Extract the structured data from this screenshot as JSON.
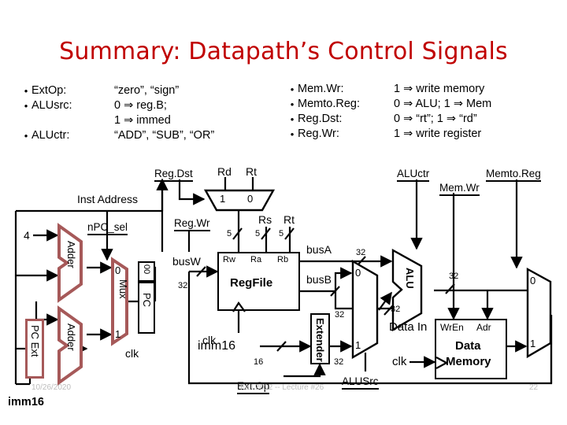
{
  "slide": {
    "title": "Summary: Datapath’s Control Signals"
  },
  "bullets_left": [
    {
      "name": "ExtOp:",
      "value": "“zero”, “sign”"
    },
    {
      "name": "ALUsrc:",
      "value": "0 ⇒ reg.B;"
    },
    {
      "name": "",
      "value": "1 ⇒ immed"
    },
    {
      "name": "ALUctr:",
      "value": "“ADD”, “SUB”, “OR”"
    }
  ],
  "bullets_right": [
    {
      "name": "Mem.Wr:",
      "value": "1 ⇒ write memory"
    },
    {
      "name": "Memto.Reg:",
      "value": "0 ⇒ ALU; 1 ⇒ Mem"
    },
    {
      "name": "Reg.Dst:",
      "value": "0 ⇒ “rt”; 1 ⇒ “rd”"
    },
    {
      "name": "Reg.Wr:",
      "value": "1 ⇒ write register"
    }
  ],
  "diagram": {
    "control_signals": {
      "npc_sel": "nPC_sel",
      "reg_dst": "Reg.Dst",
      "reg_wr": "Reg.Wr",
      "alu_ctr": "ALUctr",
      "mem_wr": "Mem.Wr",
      "memto_reg": "Memto.Reg",
      "ext_op": "Ext.Op",
      "alu_src": "ALUSrc"
    },
    "blocks": {
      "adder_top": "Adder",
      "adder_bottom": "Adder",
      "mux_pc": "Mux",
      "pc": "PC",
      "pc_const": "00",
      "pc_ext": "PC Ext",
      "regfile": "RegFile",
      "extender": "Extender",
      "alu": "ALU",
      "data_memory_1": "Data",
      "data_memory_2": "Memory"
    },
    "labels": {
      "four": "4",
      "inst_address": "Inst Address",
      "rd": "Rd",
      "rt_top": "Rt",
      "rs": "Rs",
      "rt_mid": "Rt",
      "rw": "Rw",
      "ra": "Ra",
      "rb": "Rb",
      "busw": "busW",
      "busa": "busA",
      "busb": "busB",
      "clk_pc": "clk",
      "clk_rf": "clk",
      "clk_dm": "clk",
      "imm16_in": "imm16",
      "imm16_left": "imm16",
      "data_in": "Data In",
      "wren": "WrEn",
      "adr": "Adr"
    },
    "mux_ports": {
      "pc_mux_0": "0",
      "pc_mux_1": "1",
      "regdst_mux_1": "1",
      "regdst_mux_0": "0",
      "alusrc_mux_0": "0",
      "alusrc_mux_1": "1",
      "memtoreg_mux_0": "0",
      "memtoreg_mux_1": "1"
    },
    "widths": {
      "w5_rw": "5",
      "w5_ra": "5",
      "w5_rb": "5",
      "w32_busw": "32",
      "w32_busa": "32",
      "w32_busb": "32",
      "w16_imm": "16",
      "w32_ext": "32",
      "w32_alu": "32",
      "w32_datain": "32",
      "w32_dm": "32"
    },
    "colors": {
      "title": "#c00000",
      "pc_block_outline": "#a65959",
      "line": "#000000",
      "footer_text": "#bdbdbd"
    }
  },
  "footer": {
    "date": "10/26/2020",
    "course": "Fall 2012 -- Lecture #26",
    "page": "22"
  }
}
